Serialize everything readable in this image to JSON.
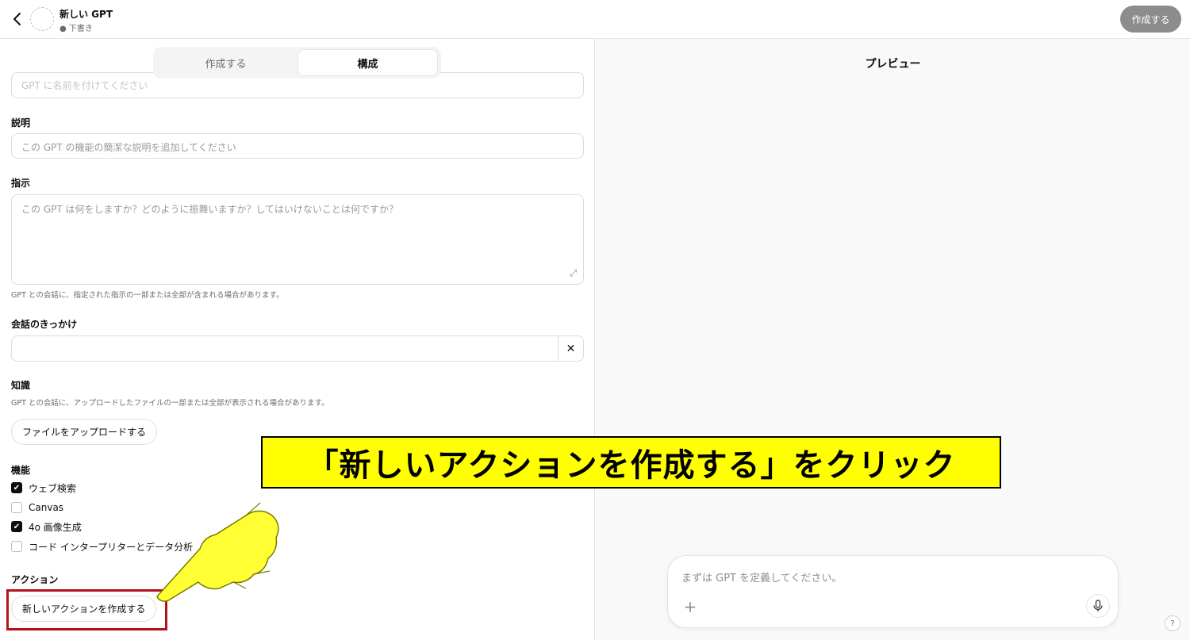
{
  "header": {
    "gpt_name": "新しい GPT",
    "status": "● 下書き",
    "create_button": "作成する"
  },
  "tabs": [
    {
      "label": "作成する",
      "active": false
    },
    {
      "label": "構成",
      "active": true
    }
  ],
  "form": {
    "name_placeholder": "GPT に名前を付けてください",
    "description_label": "説明",
    "description_placeholder": "この GPT の機能の簡潔な説明を追加してください",
    "instructions_label": "指示",
    "instructions_placeholder": "この GPT は何をしますか？どのように振舞いますか？してはいけないことは何ですか？",
    "instructions_hint": "GPT との会話に、指定された指示の一部または全部が含まれる場合があります。",
    "starters_label": "会話のきっかけ",
    "starters_clear": "✕",
    "knowledge_label": "知識",
    "knowledge_hint": "GPT との会話に、アップロードしたファイルの一部または全部が表示される場合があります。",
    "upload_button": "ファイルをアップロードする",
    "capabilities_label": "機能",
    "capabilities": [
      {
        "label": "ウェブ検索",
        "checked": true
      },
      {
        "label": "Canvas",
        "checked": false
      },
      {
        "label": "4o 画像生成",
        "checked": true
      },
      {
        "label": "コード インタープリターとデータ分析",
        "checked": false
      }
    ],
    "actions_label": "アクション",
    "new_action_button": "新しいアクションを作成する"
  },
  "preview": {
    "title": "プレビュー",
    "composer_placeholder": "まずは GPT を定義してください。",
    "help": "?"
  },
  "annotation": {
    "banner": "「新しいアクションを作成する」をクリック",
    "banner_color": "#ffff00",
    "highlight_color": "#b3131a"
  }
}
